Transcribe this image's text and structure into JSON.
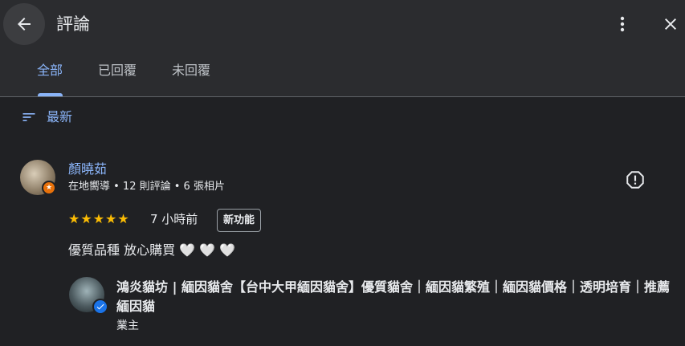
{
  "header": {
    "title": "評論",
    "back_icon": "arrow-left-icon",
    "more_icon": "more-vert-icon",
    "close_icon": "close-icon"
  },
  "tabs": [
    {
      "label": "全部",
      "active": true
    },
    {
      "label": "已回覆",
      "active": false
    },
    {
      "label": "未回覆",
      "active": false
    }
  ],
  "sort": {
    "label": "最新",
    "icon": "sort-icon"
  },
  "review": {
    "name": "顏曉茹",
    "meta": "在地嚮導 • 12 則評論 • 6 張相片",
    "rating": 5,
    "stars": "★★★★★",
    "time": "7 小時前",
    "badge": "新功能",
    "text": "優質品種 放心購買",
    "hearts": "🤍 🤍 🤍",
    "report_icon": "report-icon"
  },
  "owner_reply": {
    "name": "鴻炎貓坊 | 緬因貓舍【台中大甲緬因貓舍】優質貓舍｜緬因貓繁殖｜緬因貓價格｜透明培育｜推薦緬因貓",
    "role": "業主",
    "verified_icon": "verified-check-icon"
  },
  "colors": {
    "accent": "#8ab4f8",
    "star": "#fbbc04",
    "background": "#202124",
    "header_bg": "#2b2c2f"
  }
}
